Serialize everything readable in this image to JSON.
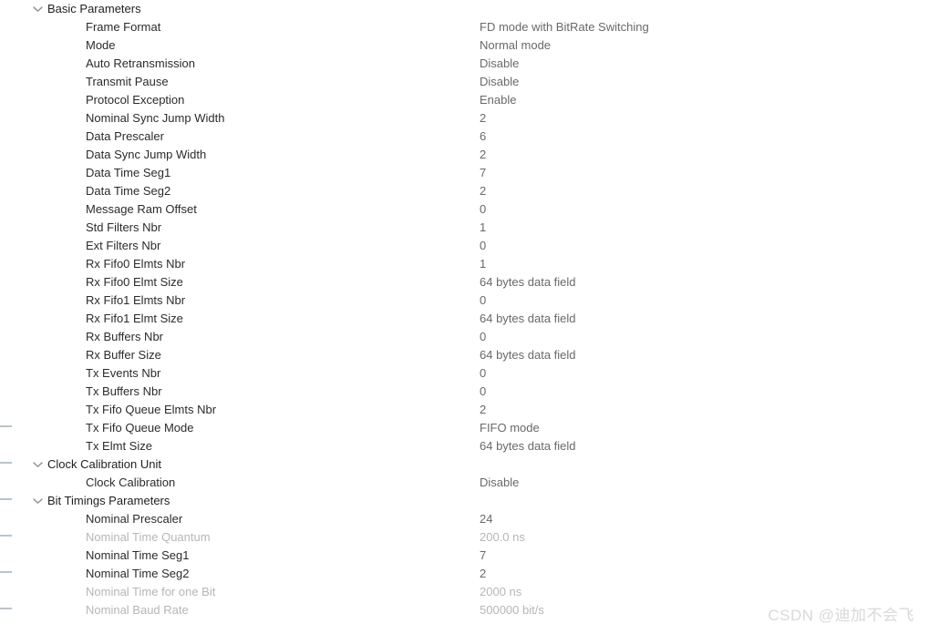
{
  "watermark": "CSDN @迪加不会飞",
  "scrollbar": {
    "thumb_color": "#c0ced7",
    "track_color": "#ffffff"
  },
  "colors": {
    "label": "#2b2b2b",
    "group_label": "#1f1f1f",
    "value": "#696969",
    "disabled": "#b6b6b6",
    "chevron": "#808a90",
    "background": "#ffffff"
  },
  "gutter_ticks": [
    467,
    507,
    547,
    587,
    627,
    667
  ],
  "tree": {
    "sections": [
      {
        "id": "basic-parameters",
        "label": "Basic Parameters",
        "expanded": true,
        "chevron_icon": "chevron-down-icon",
        "rows": [
          {
            "label": "Frame Format",
            "value": "FD mode with BitRate Switching",
            "disabled": false
          },
          {
            "label": "Mode",
            "value": "Normal mode",
            "disabled": false
          },
          {
            "label": "Auto Retransmission",
            "value": "Disable",
            "disabled": false
          },
          {
            "label": "Transmit Pause",
            "value": "Disable",
            "disabled": false
          },
          {
            "label": "Protocol Exception",
            "value": "Enable",
            "disabled": false
          },
          {
            "label": "Nominal Sync Jump Width",
            "value": "2",
            "disabled": false
          },
          {
            "label": "Data Prescaler",
            "value": "6",
            "disabled": false
          },
          {
            "label": "Data Sync Jump Width",
            "value": "2",
            "disabled": false
          },
          {
            "label": "Data Time Seg1",
            "value": "7",
            "disabled": false
          },
          {
            "label": "Data Time Seg2",
            "value": "2",
            "disabled": false
          },
          {
            "label": "Message Ram Offset",
            "value": "0",
            "disabled": false
          },
          {
            "label": "Std Filters Nbr",
            "value": "1",
            "disabled": false
          },
          {
            "label": "Ext Filters Nbr",
            "value": "0",
            "disabled": false
          },
          {
            "label": "Rx Fifo0 Elmts Nbr",
            "value": "1",
            "disabled": false
          },
          {
            "label": "Rx Fifo0 Elmt Size",
            "value": "64 bytes data field",
            "disabled": false
          },
          {
            "label": "Rx Fifo1 Elmts Nbr",
            "value": "0",
            "disabled": false
          },
          {
            "label": "Rx Fifo1 Elmt Size",
            "value": "64 bytes data field",
            "disabled": false
          },
          {
            "label": "Rx Buffers Nbr",
            "value": "0",
            "disabled": false
          },
          {
            "label": "Rx Buffer Size",
            "value": "64 bytes data field",
            "disabled": false
          },
          {
            "label": "Tx Events Nbr",
            "value": "0",
            "disabled": false
          },
          {
            "label": "Tx Buffers Nbr",
            "value": "0",
            "disabled": false
          },
          {
            "label": "Tx Fifo Queue Elmts Nbr",
            "value": "2",
            "disabled": false
          },
          {
            "label": "Tx Fifo Queue Mode",
            "value": "FIFO mode",
            "disabled": false
          },
          {
            "label": "Tx Elmt Size",
            "value": "64 bytes data field",
            "disabled": false
          }
        ]
      },
      {
        "id": "clock-calibration-unit",
        "label": "Clock Calibration Unit",
        "expanded": true,
        "chevron_icon": "chevron-down-icon",
        "rows": [
          {
            "label": "Clock Calibration",
            "value": "Disable",
            "disabled": false
          }
        ]
      },
      {
        "id": "bit-timings-parameters",
        "label": "Bit Timings Parameters",
        "expanded": true,
        "chevron_icon": "chevron-down-icon",
        "rows": [
          {
            "label": "Nominal Prescaler",
            "value": "24",
            "disabled": false
          },
          {
            "label": "Nominal Time Quantum",
            "value": "200.0 ns",
            "disabled": true
          },
          {
            "label": "Nominal Time Seg1",
            "value": "7",
            "disabled": false
          },
          {
            "label": "Nominal Time Seg2",
            "value": "2",
            "disabled": false
          },
          {
            "label": "Nominal Time for one Bit",
            "value": "2000 ns",
            "disabled": true
          },
          {
            "label": "Nominal Baud Rate",
            "value": "500000 bit/s",
            "disabled": true
          }
        ]
      }
    ]
  }
}
